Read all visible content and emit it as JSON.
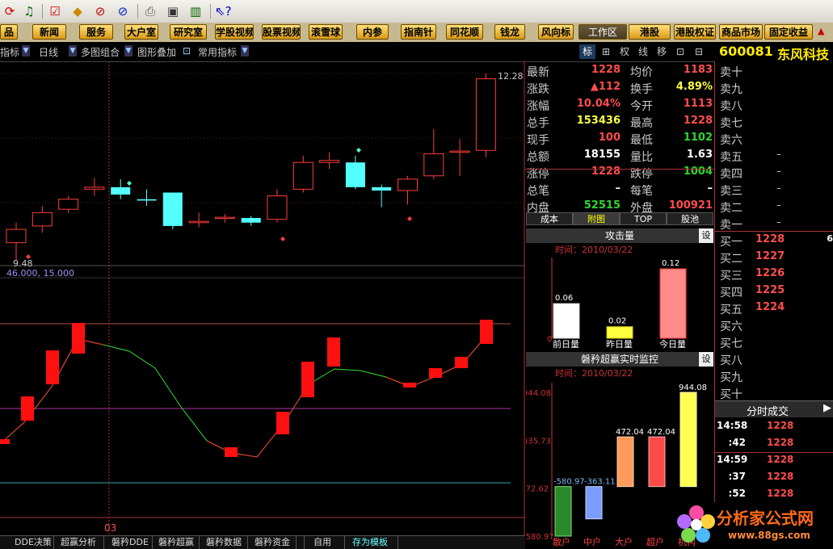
{
  "menu": [
    "品",
    "新闻",
    "服务",
    "大户室",
    "研究室",
    "学股视频",
    "股票视频",
    "滚雪球",
    "内参",
    "指南针",
    "同花顺",
    "钱龙",
    "风向标",
    "工作区",
    "港股",
    "港股权证",
    "商品市场",
    "固定收益"
  ],
  "chart_toolbar": {
    "indicator": "指标",
    "period": "日线",
    "combo": "多图组合",
    "overlay": "图形叠加",
    "common": "常用指标"
  },
  "right_tabs": [
    "标",
    "⊞",
    "权",
    "线",
    "移",
    "⊡",
    "⊟"
  ],
  "stock": {
    "code": "600081",
    "name": "东风科技"
  },
  "quote": [
    {
      "label": "最新",
      "value": "1228",
      "color": "red"
    },
    {
      "label": "均价",
      "value": "1183",
      "color": "red"
    },
    {
      "label": "涨跌",
      "value": "▲112",
      "color": "red"
    },
    {
      "label": "换手",
      "value": "4.89%",
      "color": "yellow"
    },
    {
      "label": "涨幅",
      "value": "10.04%",
      "color": "red"
    },
    {
      "label": "今开",
      "value": "1113",
      "color": "red"
    },
    {
      "label": "总手",
      "value": "153436",
      "color": "yellow"
    },
    {
      "label": "最高",
      "value": "1228",
      "color": "red"
    },
    {
      "label": "现手",
      "value": "100",
      "color": "red"
    },
    {
      "label": "最低",
      "value": "1102",
      "color": "green"
    },
    {
      "label": "总额",
      "value": "18155",
      "color": "white"
    },
    {
      "label": "量比",
      "value": "1.63",
      "color": "white"
    },
    {
      "label": "涨停",
      "value": "1228",
      "color": "red"
    },
    {
      "label": "跌停",
      "value": "1004",
      "color": "green"
    },
    {
      "label": "总笔",
      "value": "–",
      "color": "white"
    },
    {
      "label": "每笔",
      "value": "–",
      "color": "white"
    },
    {
      "label": "内盘",
      "value": "52515",
      "color": "green"
    },
    {
      "label": "外盘",
      "value": "100921",
      "color": "red"
    }
  ],
  "sub_tabs": [
    "成本",
    "附图",
    "TOP",
    "股池"
  ],
  "panel1": {
    "title": "攻击量",
    "set": "设",
    "date": "时间：2010/03/22",
    "bars": [
      {
        "label": "前日量",
        "value": "0.06"
      },
      {
        "label": "昨日量",
        "value": "0.02"
      },
      {
        "label": "今日量",
        "value": "0.12"
      }
    ],
    "axis0": "0"
  },
  "panel2": {
    "title": "磐矜超赢实时监控",
    "set": "设",
    "date": "时间：2010/03/22",
    "axis": [
      "944.08",
      "435.73",
      "-72.62",
      "-580.97"
    ],
    "bars": [
      {
        "label": "散户",
        "value": "-580.97"
      },
      {
        "label": "中户",
        "value": "-363.11"
      },
      {
        "label": "大户",
        "value": "472.04"
      },
      {
        "label": "超户",
        "value": "472.04"
      },
      {
        "label": "机构",
        "value": "944.08"
      }
    ]
  },
  "sell": [
    {
      "label": "卖十",
      "p": "",
      "v": ""
    },
    {
      "label": "卖九",
      "p": "",
      "v": ""
    },
    {
      "label": "卖八",
      "p": "",
      "v": ""
    },
    {
      "label": "卖七",
      "p": "",
      "v": ""
    },
    {
      "label": "卖六",
      "p": "",
      "v": ""
    },
    {
      "label": "卖五",
      "p": "",
      "v": "–"
    },
    {
      "label": "卖四",
      "p": "",
      "v": "–"
    },
    {
      "label": "卖三",
      "p": "",
      "v": "–"
    },
    {
      "label": "卖二",
      "p": "",
      "v": "–"
    },
    {
      "label": "卖一",
      "p": "",
      "v": "–"
    }
  ],
  "buy": [
    {
      "label": "买一",
      "p": "1228",
      "v": "6"
    },
    {
      "label": "买二",
      "p": "1227",
      "v": ""
    },
    {
      "label": "买三",
      "p": "1226",
      "v": ""
    },
    {
      "label": "买四",
      "p": "1225",
      "v": ""
    },
    {
      "label": "买五",
      "p": "1224",
      "v": ""
    },
    {
      "label": "买六",
      "p": "",
      "v": ""
    },
    {
      "label": "买七",
      "p": "",
      "v": ""
    },
    {
      "label": "买八",
      "p": "",
      "v": ""
    },
    {
      "label": "买九",
      "p": "",
      "v": ""
    },
    {
      "label": "买十",
      "p": "",
      "v": ""
    }
  ],
  "ticks_title": "分时成交",
  "ticks": [
    {
      "t": "14:58",
      "p": "1228"
    },
    {
      "t": ":42",
      "p": "1228"
    },
    {
      "t": "14:59",
      "p": "1228"
    },
    {
      "t": ":37",
      "p": "1228"
    },
    {
      "t": ":52",
      "p": "1228"
    }
  ],
  "main_chart": {
    "high_label": "12.28",
    "low_label": "9.48"
  },
  "indicator_params": "46.000, 15.000",
  "date_marker": "03",
  "bottom_tabs": [
    "DDE决策",
    "超赢分析",
    "磐矜DDE",
    "磐矜超赢",
    "磐矜数据",
    "磐矜资金",
    "自用",
    "存为模板"
  ],
  "watermark": {
    "site": "分析家公式网",
    "url": "www.88gs.com"
  },
  "chart_data": [
    {
      "type": "candlestick",
      "title": "",
      "candles": [
        {
          "o": 9.75,
          "c": 9.95,
          "h": 10.05,
          "l": 9.48
        },
        {
          "o": 10.0,
          "c": 10.2,
          "h": 10.3,
          "l": 9.9
        },
        {
          "o": 10.25,
          "c": 10.4,
          "h": 10.45,
          "l": 10.2
        },
        {
          "o": 10.55,
          "c": 10.58,
          "h": 10.72,
          "l": 10.45
        },
        {
          "o": 10.58,
          "c": 10.47,
          "h": 10.7,
          "l": 10.4
        },
        {
          "o": 10.4,
          "c": 10.38,
          "h": 10.55,
          "l": 10.3
        },
        {
          "o": 10.5,
          "c": 10.0,
          "h": 10.5,
          "l": 9.95
        },
        {
          "o": 10.05,
          "c": 10.07,
          "h": 10.2,
          "l": 9.98
        },
        {
          "o": 10.12,
          "c": 10.13,
          "h": 10.18,
          "l": 10.05
        },
        {
          "o": 10.12,
          "c": 10.05,
          "h": 10.15,
          "l": 10.0
        },
        {
          "o": 10.1,
          "c": 10.45,
          "h": 10.55,
          "l": 10.05
        },
        {
          "o": 10.55,
          "c": 10.95,
          "h": 11.05,
          "l": 10.5
        },
        {
          "o": 10.95,
          "c": 10.98,
          "h": 11.1,
          "l": 10.85
        },
        {
          "o": 10.95,
          "c": 10.58,
          "h": 11.05,
          "l": 10.55
        },
        {
          "o": 10.58,
          "c": 10.53,
          "h": 10.62,
          "l": 10.28
        },
        {
          "o": 10.53,
          "c": 10.7,
          "h": 10.75,
          "l": 10.32
        },
        {
          "o": 10.75,
          "c": 11.08,
          "h": 11.45,
          "l": 10.7
        },
        {
          "o": 11.1,
          "c": 11.12,
          "h": 11.3,
          "l": 10.75
        },
        {
          "o": 11.13,
          "c": 12.2,
          "h": 12.28,
          "l": 11.03
        }
      ]
    },
    {
      "type": "bar",
      "title": "攻击量",
      "categories": [
        "前日量",
        "昨日量",
        "今日量"
      ],
      "values": [
        0.06,
        0.02,
        0.12
      ],
      "ylim": [
        0,
        0.12
      ]
    },
    {
      "type": "bar",
      "title": "磐矜超赢实时监控",
      "categories": [
        "散户",
        "中户",
        "大户",
        "超户",
        "机构"
      ],
      "values": [
        -580.97,
        -363.11,
        472.04,
        472.04,
        944.08
      ],
      "ylim": [
        -580.97,
        944.08
      ]
    }
  ]
}
